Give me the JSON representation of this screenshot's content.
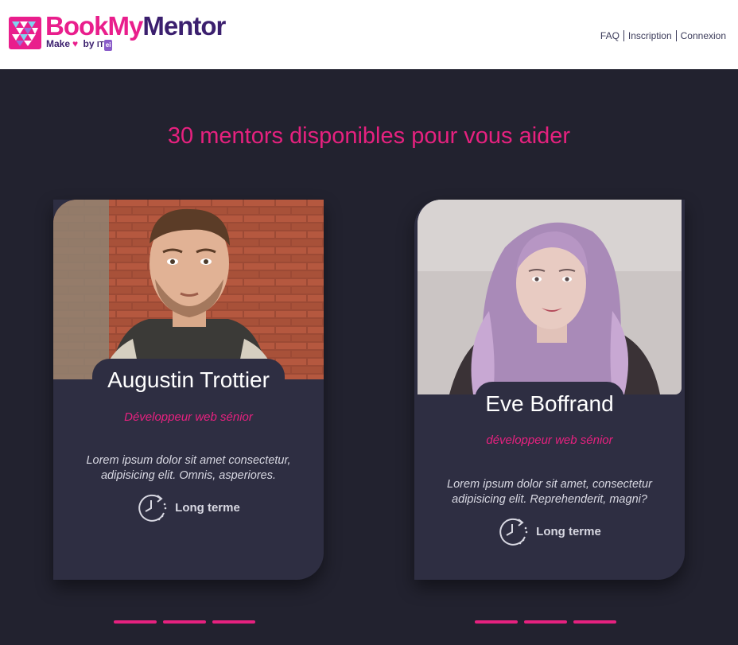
{
  "header": {
    "logo": {
      "part1": "Book",
      "part2": "My",
      "part3": "Mentor",
      "tagline_make": "Make",
      "tagline_by": "by",
      "tagline_it": "IT",
      "tagline_badge": "ei"
    },
    "nav": [
      "FAQ",
      "Inscription",
      "Connexion"
    ]
  },
  "headline": "30 mentors disponibles pour vous aider",
  "mentors": [
    {
      "name": "Augustin Trottier",
      "role": "Développeur web sénior",
      "description": "Lorem ipsum dolor sit amet consectetur, adipisicing elit. Omnis, asperiores.",
      "duration": "Long terme"
    },
    {
      "name": "Eve Boffrand",
      "role": "développeur web sénior",
      "description": "Lorem ipsum dolor sit amet, consectetur adipisicing elit. Reprehenderit, magni?",
      "duration": "Long terme"
    }
  ],
  "icons": [
    "logo-mark-icon",
    "heart-icon",
    "clock-icon"
  ],
  "colors": {
    "accent": "#e6217f",
    "brand_dark": "#3b1f6e",
    "background": "#22222f",
    "card": "#2e2e42"
  }
}
